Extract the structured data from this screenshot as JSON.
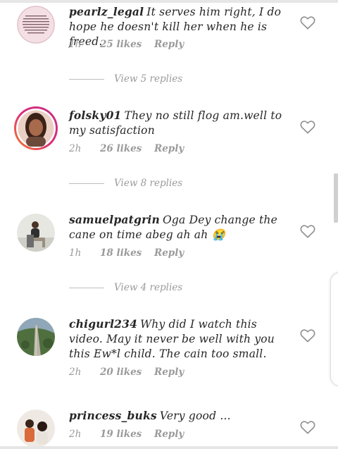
{
  "comments": [
    {
      "username": "pearlz_legal",
      "text": "It serves him right, I do hope he doesn't kill her when he is freed.",
      "time": "1h",
      "likes": "25 likes",
      "reply": "Reply",
      "view_replies": "View 5 replies",
      "avatar_text": "HERE IS NOTHING MORE ALL WOMAN ...",
      "avatar_icon": "text-quote-avatar"
    },
    {
      "username": "folsky01",
      "text": "They no still flog am.well to my satisfaction",
      "time": "2h",
      "likes": "26 likes",
      "reply": "Reply",
      "view_replies": "View 8 replies",
      "avatar_icon": "story-ring-avatar"
    },
    {
      "username": "samuelpatgrin",
      "text": "Oga Dey change the cane on time abeg  ah ah 😭",
      "time": "1h",
      "likes": "18 likes",
      "reply": "Reply",
      "view_replies": "View 4 replies",
      "avatar_icon": "person-seated-avatar"
    },
    {
      "username": "chigurl234",
      "text": "Why did I watch this video. May it never be well with you this Ew*l child. The cain too small.",
      "time": "2h",
      "likes": "20 likes",
      "reply": "Reply",
      "avatar_icon": "road-landscape-avatar"
    },
    {
      "username": "princess_buks",
      "text": "Very good ...",
      "time": "2h",
      "likes": "19 likes",
      "reply": "Reply",
      "avatar_icon": "salon-avatar"
    }
  ],
  "colors": {
    "muted_text": "#9a9a9a",
    "primary_text": "#262626",
    "story_ring_start": "#f58529",
    "story_ring_end": "#c13584"
  }
}
